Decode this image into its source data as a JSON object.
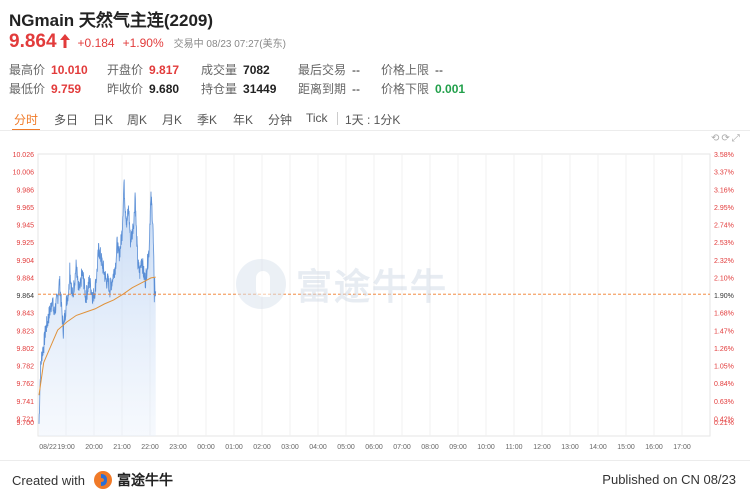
{
  "header": {
    "title": "NGmain 天然气主连(2209)",
    "price": "9.864",
    "change": "+0.184",
    "change_pct": "+1.90%",
    "status": "交易中 08/23 07:27(美东)"
  },
  "stats": {
    "high_label": "最高价",
    "high": "10.010",
    "low_label": "最低价",
    "low": "9.759",
    "open_label": "开盘价",
    "open": "9.817",
    "prev_close_label": "昨收价",
    "prev_close": "9.680",
    "volume_label": "成交量",
    "volume": "7082",
    "open_interest_label": "持仓量",
    "open_interest": "31449",
    "last_trade_label": "最后交易",
    "last_trade": "--",
    "expiry_label": "距离到期",
    "expiry": "--",
    "upper_limit_label": "价格上限",
    "upper_limit": "--",
    "lower_limit_label": "价格下限",
    "lower_limit": "0.001"
  },
  "tabs": [
    "分时",
    "多日",
    "日K",
    "周K",
    "月K",
    "季K",
    "年K",
    "分钟",
    "Tick",
    "1天 : 1分K"
  ],
  "active_tab": "分时",
  "colors": {
    "up": "#e23b3b",
    "down": "#22a04b",
    "accent": "#f07a28",
    "line": "#5b8fd6",
    "avg": "#e0923a"
  },
  "chart_data": {
    "type": "area",
    "y_ticks_left": [
      "10.026",
      "10.006",
      "9.986",
      "9.965",
      "9.945",
      "9.925",
      "9.904",
      "9.884",
      "9.864",
      "9.843",
      "9.823",
      "9.802",
      "9.782",
      "9.762",
      "9.741",
      "9.721",
      "9.700"
    ],
    "y_ticks_right": [
      "3.58%",
      "3.37%",
      "3.16%",
      "2.95%",
      "2.74%",
      "2.53%",
      "2.32%",
      "2.10%",
      "1.90%",
      "1.68%",
      "1.47%",
      "1.26%",
      "1.05%",
      "0.84%",
      "0.63%",
      "0.42%",
      "0.21%"
    ],
    "x_ticks": [
      "08/22",
      "19:00",
      "20:00",
      "21:00",
      "22:00",
      "23:00",
      "00:00",
      "01:00",
      "02:00",
      "03:00",
      "04:00",
      "05:00",
      "06:00",
      "07:00",
      "08:00",
      "09:00",
      "10:00",
      "11:00",
      "12:00",
      "13:00",
      "14:00",
      "15:00",
      "16:00",
      "17:00"
    ],
    "ylim": [
      9.69,
      10.036
    ],
    "current_price": 9.864,
    "price_anchors": [
      [
        0,
        9.705
      ],
      [
        3,
        9.77
      ],
      [
        6,
        9.79
      ],
      [
        10,
        9.8
      ],
      [
        14,
        9.82
      ],
      [
        18,
        9.83
      ],
      [
        22,
        9.84
      ],
      [
        26,
        9.85
      ],
      [
        28,
        9.86
      ],
      [
        32,
        9.84
      ],
      [
        36,
        9.85
      ],
      [
        40,
        9.86
      ],
      [
        44,
        9.88
      ],
      [
        48,
        9.85
      ],
      [
        52,
        9.82
      ],
      [
        56,
        9.84
      ],
      [
        60,
        9.86
      ],
      [
        64,
        9.87
      ],
      [
        66,
        9.9
      ],
      [
        68,
        9.88
      ],
      [
        72,
        9.86
      ],
      [
        76,
        9.88
      ],
      [
        80,
        9.9
      ],
      [
        84,
        9.87
      ],
      [
        88,
        9.87
      ],
      [
        92,
        9.89
      ],
      [
        96,
        9.88
      ],
      [
        100,
        9.86
      ],
      [
        104,
        9.87
      ],
      [
        108,
        9.88
      ],
      [
        112,
        9.87
      ],
      [
        116,
        9.86
      ],
      [
        120,
        9.87
      ],
      [
        124,
        9.89
      ],
      [
        128,
        9.92
      ],
      [
        132,
        9.91
      ],
      [
        136,
        9.9
      ],
      [
        140,
        9.89
      ],
      [
        144,
        9.88
      ],
      [
        148,
        9.88
      ],
      [
        152,
        9.87
      ],
      [
        156,
        9.88
      ],
      [
        160,
        9.89
      ],
      [
        164,
        9.9
      ],
      [
        168,
        9.93
      ],
      [
        170,
        9.91
      ],
      [
        174,
        9.92
      ],
      [
        178,
        9.94
      ],
      [
        180,
        9.97
      ],
      [
        182,
        10.0
      ],
      [
        184,
        9.98
      ],
      [
        188,
        9.95
      ],
      [
        192,
        9.97
      ],
      [
        196,
        9.93
      ],
      [
        200,
        9.94
      ],
      [
        204,
        9.96
      ],
      [
        206,
        9.99
      ],
      [
        208,
        9.95
      ],
      [
        212,
        9.9
      ],
      [
        216,
        9.89
      ],
      [
        220,
        9.91
      ],
      [
        224,
        9.89
      ],
      [
        228,
        9.88
      ],
      [
        232,
        9.9
      ],
      [
        236,
        9.92
      ],
      [
        238,
        9.96
      ],
      [
        240,
        9.98
      ],
      [
        242,
        9.97
      ],
      [
        244,
        9.95
      ],
      [
        246,
        9.9
      ],
      [
        247,
        9.86
      ],
      [
        248,
        9.88
      ],
      [
        249,
        9.86
      ],
      [
        250,
        9.87
      ]
    ],
    "avg_anchors": [
      [
        0,
        9.74
      ],
      [
        10,
        9.78
      ],
      [
        25,
        9.8
      ],
      [
        40,
        9.82
      ],
      [
        60,
        9.83
      ],
      [
        80,
        9.838
      ],
      [
        100,
        9.842
      ],
      [
        120,
        9.846
      ],
      [
        140,
        9.852
      ],
      [
        160,
        9.857
      ],
      [
        180,
        9.864
      ],
      [
        200,
        9.872
      ],
      [
        220,
        9.878
      ],
      [
        240,
        9.884
      ],
      [
        250,
        9.885
      ]
    ]
  },
  "footer": {
    "created_with": "Created with",
    "brand": "富途牛牛",
    "published": "Published on CN 08/23"
  },
  "watermark": "富途牛牛"
}
